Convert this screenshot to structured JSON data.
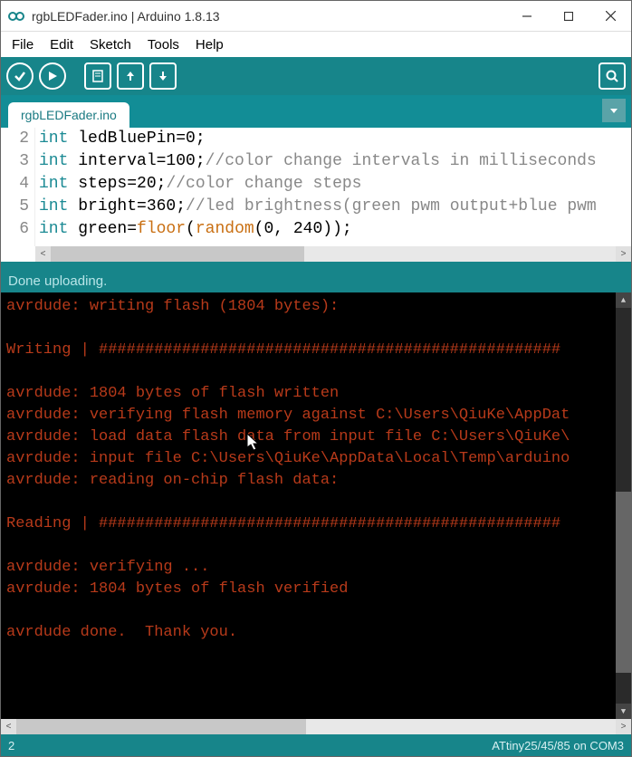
{
  "window": {
    "title": "rgbLEDFader.ino | Arduino 1.8.13"
  },
  "menu": {
    "file": "File",
    "edit": "Edit",
    "sketch": "Sketch",
    "tools": "Tools",
    "help": "Help"
  },
  "tab": {
    "name": "rgbLEDFader.ino"
  },
  "code": {
    "lines": [
      {
        "n": "2",
        "tokens": [
          {
            "t": "int ",
            "c": "kw"
          },
          {
            "t": "ledBluePin=0;",
            "c": "txt"
          }
        ]
      },
      {
        "n": "3",
        "tokens": [
          {
            "t": "int ",
            "c": "kw"
          },
          {
            "t": "interval=100;",
            "c": "txt"
          },
          {
            "t": "//color change intervals in milliseconds",
            "c": "com"
          }
        ]
      },
      {
        "n": "4",
        "tokens": [
          {
            "t": "int ",
            "c": "kw"
          },
          {
            "t": "steps=20;",
            "c": "txt"
          },
          {
            "t": "//color change steps",
            "c": "com"
          }
        ]
      },
      {
        "n": "5",
        "tokens": [
          {
            "t": "int ",
            "c": "kw"
          },
          {
            "t": "bright=360;",
            "c": "txt"
          },
          {
            "t": "//led brightness(green pwm output+blue pwm",
            "c": "com"
          }
        ]
      },
      {
        "n": "6",
        "tokens": [
          {
            "t": "int ",
            "c": "kw"
          },
          {
            "t": "green=",
            "c": "txt"
          },
          {
            "t": "floor",
            "c": "fn"
          },
          {
            "t": "(",
            "c": "txt"
          },
          {
            "t": "random",
            "c": "fn"
          },
          {
            "t": "(0, 240));",
            "c": "txt"
          }
        ]
      }
    ]
  },
  "status": {
    "message": "Done uploading."
  },
  "console": {
    "lines": [
      "avrdude: writing flash (1804 bytes):",
      "",
      "Writing | ##################################################",
      "",
      "avrdude: 1804 bytes of flash written",
      "avrdude: verifying flash memory against C:\\Users\\QiuKe\\AppDat",
      "avrdude: load data flash data from input file C:\\Users\\QiuKe\\",
      "avrdude: input file C:\\Users\\QiuKe\\AppData\\Local\\Temp\\arduino",
      "avrdude: reading on-chip flash data:",
      "",
      "Reading | ##################################################",
      "",
      "avrdude: verifying ...",
      "avrdude: 1804 bytes of flash verified",
      "",
      "avrdude done.  Thank you.",
      ""
    ]
  },
  "footer": {
    "line_col": "2",
    "board": "ATtiny25/45/85 on COM3"
  }
}
